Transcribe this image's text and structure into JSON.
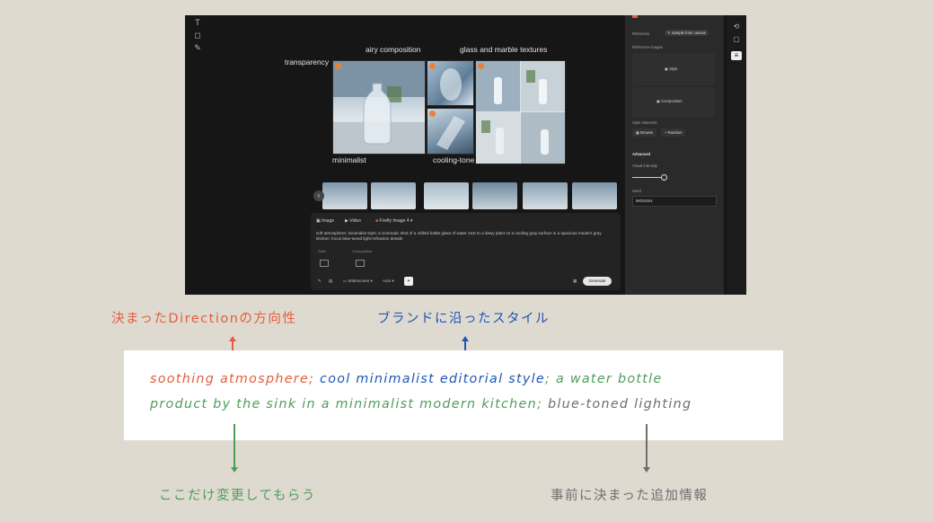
{
  "colors": {
    "red": "#e45d3e",
    "blue": "#1f56b5",
    "green": "#4f9d5a",
    "gray": "#6e6e6e",
    "badge": "#e8823a"
  },
  "app": {
    "canvas_labels": {
      "airy": "airy composition",
      "glass": "glass and marble textures",
      "transparency": "transparency",
      "minimalist": "minimalist",
      "cooling": "cooling-tone"
    },
    "left_tools": [
      "text-icon",
      "select-icon",
      "brush-icon"
    ],
    "prompt": {
      "tab_image": "Image",
      "tab_video": "Video",
      "model": "Firefly Image 4",
      "text": "soft atmosphere; minimalist style; a cinematic shot of a chilled bottle glass of water next to a dewy plant on a cooling gray surface in a spacious modern gray kitchen; focus blue-toned light-refraction details",
      "label_style": "Style",
      "label_composition": "Composition",
      "aspect": "Widescreen",
      "auto": "Auto",
      "generate": "Generate"
    },
    "panel": {
      "sample_button": "Sample from canvas",
      "reference_label": "Reference images",
      "style_label": "Style",
      "composition_label": "Composition",
      "style_section": "Style elements",
      "browse": "Browse",
      "random": "Random",
      "advanced": "Advanced",
      "visual_intensity": "Visual intensity",
      "seed_label": "Seed",
      "seed_value": "98028254"
    }
  },
  "annotations": {
    "direction": "決まったDirectionの方向性",
    "brand": "ブランドに沿ったスタイル",
    "change": "ここだけ変更してもらう",
    "added": "事前に決まった追加情報"
  },
  "prompt_card": {
    "line1": {
      "red": "soothing atmosphere;",
      "blue": "cool minimalist editorial style",
      "green": "; a water bottle"
    },
    "line2": {
      "green": "product by the sink in a minimalist modern kitchen;",
      "gray": "blue-toned lighting"
    }
  }
}
